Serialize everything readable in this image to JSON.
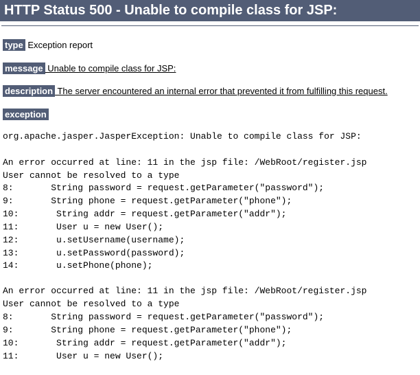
{
  "header": "HTTP Status 500 - Unable to compile class for JSP:",
  "labels": {
    "type": "type",
    "message": "message",
    "description": "description",
    "exception": "exception"
  },
  "type_text": " Exception report",
  "message_text": " Unable to compile class for JSP:",
  "description_text": " The server encountered an internal error that prevented it from fulfilling this request.",
  "stack1": "org.apache.jasper.JasperException: Unable to compile class for JSP:\n\nAn error occurred at line: 11 in the jsp file: /WebRoot/register.jsp\nUser cannot be resolved to a type\n8:       String password = request.getParameter(\"password\");\n9:       String phone = request.getParameter(\"phone\");\n10:       String addr = request.getParameter(\"addr\");\n11:       User u = new User();\n12:       u.setUsername(username);\n13:       u.setPassword(password);\n14:       u.setPhone(phone);",
  "stack2": "An error occurred at line: 11 in the jsp file: /WebRoot/register.jsp\nUser cannot be resolved to a type\n8:       String password = request.getParameter(\"password\");\n9:       String phone = request.getParameter(\"phone\");\n10:       String addr = request.getParameter(\"addr\");\n11:       User u = new User();"
}
